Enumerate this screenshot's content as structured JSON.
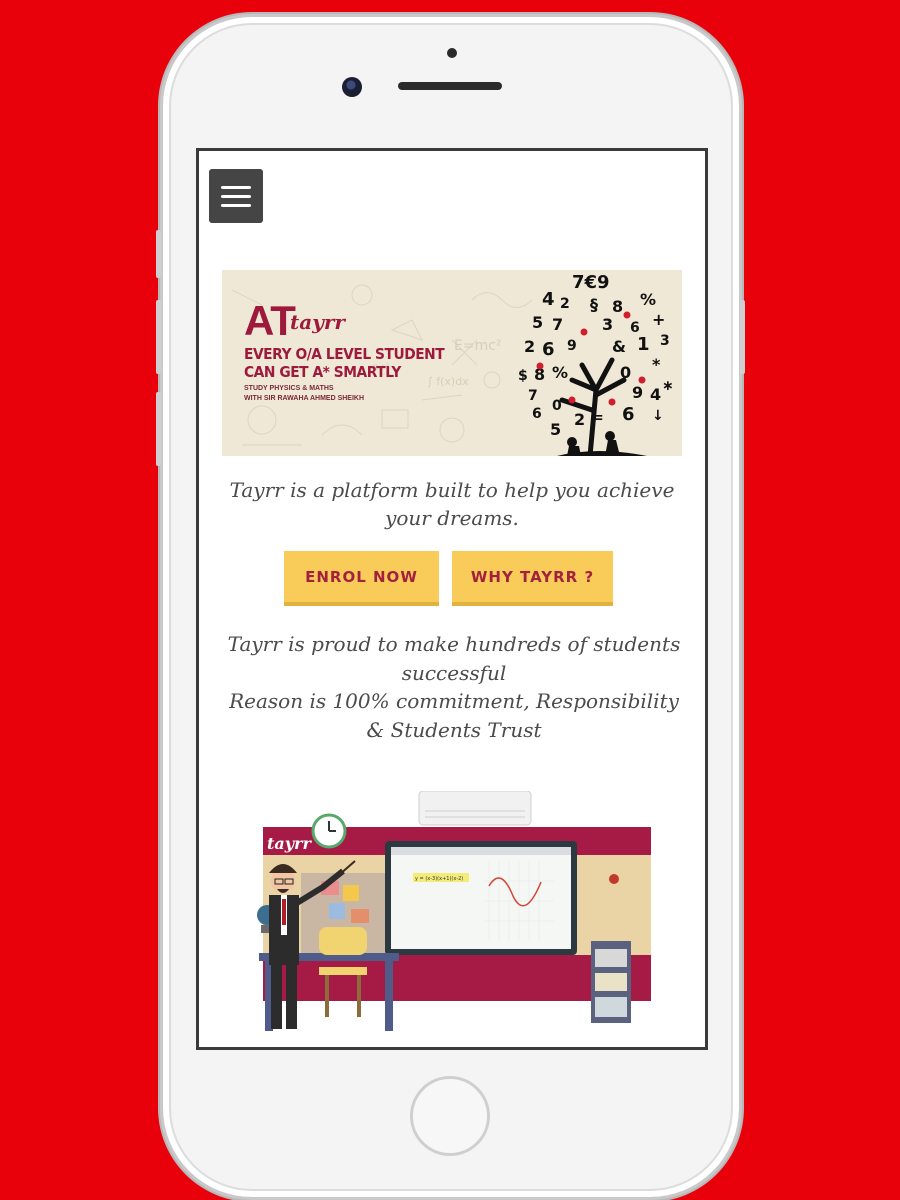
{
  "banner": {
    "at": "AT",
    "logo": "tayrr",
    "line1": "EVERY O/A LEVEL STUDENT",
    "line2": "CAN GET A* SMARTLY",
    "line3": "STUDY PHYSICS & MATHS",
    "line4": "WITH SIR RAWAHA AHMED SHEIKH"
  },
  "intro": {
    "tagline": "Tayrr is a platform built to help you achieve your dreams."
  },
  "buttons": {
    "enrol": "ENROL NOW",
    "why": "WHY TAYRR ?"
  },
  "proud": {
    "line1": "Tayrr is proud to make hundreds of students successful",
    "line2": "Reason is 100% commitment, Responsibility & Students Trust"
  },
  "illustration": {
    "logo": "tayrr",
    "screen_formula": "y = (x-3)(x+1)(x-2)"
  },
  "colors": {
    "background": "#e8000b",
    "brand": "#9e1a3c",
    "button": "#f9cc5a",
    "button_text": "#a4213d"
  }
}
